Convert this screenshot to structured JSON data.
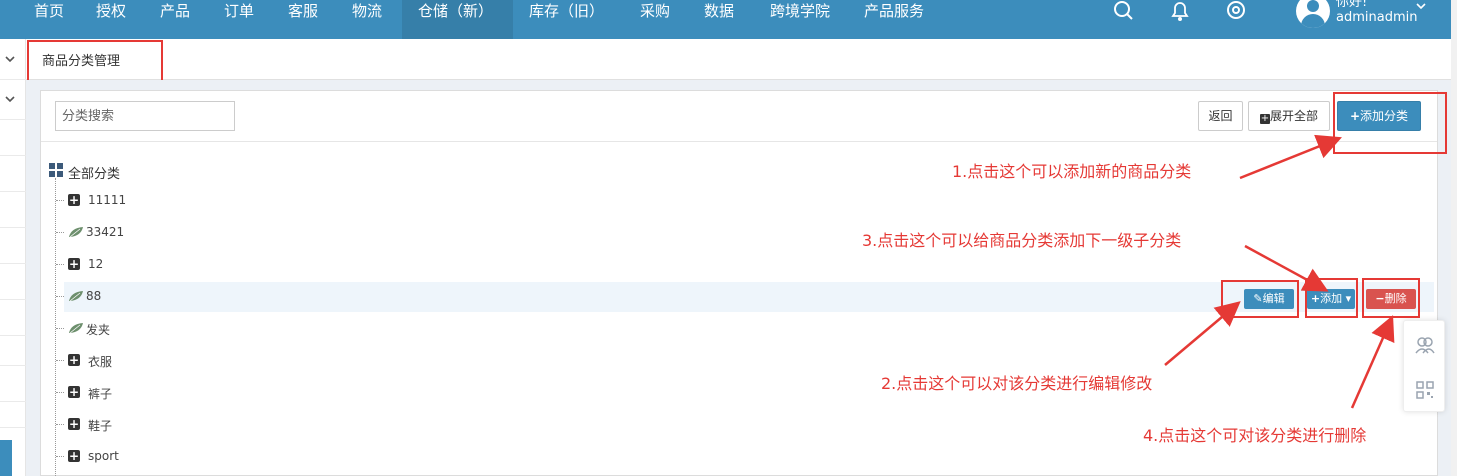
{
  "topnav": {
    "items": [
      "首页",
      "授权",
      "产品",
      "订单",
      "客服",
      "物流",
      "仓储（新）",
      "库存（旧）",
      "采购",
      "数据",
      "跨境学院",
      "产品服务"
    ],
    "active_index": 6,
    "icons": [
      "search-icon",
      "bell-icon",
      "gear-icon"
    ],
    "user": {
      "greeting": "你好!",
      "name": "adminadmin"
    }
  },
  "breadcrumb": {
    "tab": "商品分类管理"
  },
  "panel": {
    "search_placeholder": "分类搜索",
    "buttons": {
      "back": "返回",
      "expand_all": "展开全部",
      "add_category": "添加分类"
    }
  },
  "tree": {
    "root": "全部分类",
    "items": [
      {
        "label": "11111",
        "type": "folder"
      },
      {
        "label": "33421",
        "type": "leaf"
      },
      {
        "label": "12",
        "type": "folder"
      },
      {
        "label": "88",
        "type": "leaf"
      },
      {
        "label": "发夹",
        "type": "leaf"
      },
      {
        "label": "衣服",
        "type": "folder"
      },
      {
        "label": "裤子",
        "type": "folder"
      },
      {
        "label": "鞋子",
        "type": "folder"
      },
      {
        "label": "sport",
        "type": "folder"
      }
    ],
    "row_actions": {
      "edit": "编辑",
      "add": "添加",
      "delete": "删除"
    }
  },
  "annotations": {
    "a1": "1.点击这个可以添加新的商品分类",
    "a2": "2.点击这个可以对该分类进行编辑修改",
    "a3": "3.点击这个可以给商品分类添加下一级子分类",
    "a4": "4.点击这个可对该分类进行删除"
  },
  "colors": {
    "nav": "#3c8dbc",
    "nav_active": "#367fa9",
    "primary": "#3c8dbc",
    "danger": "#d9534f",
    "annotation": "#e53935"
  }
}
